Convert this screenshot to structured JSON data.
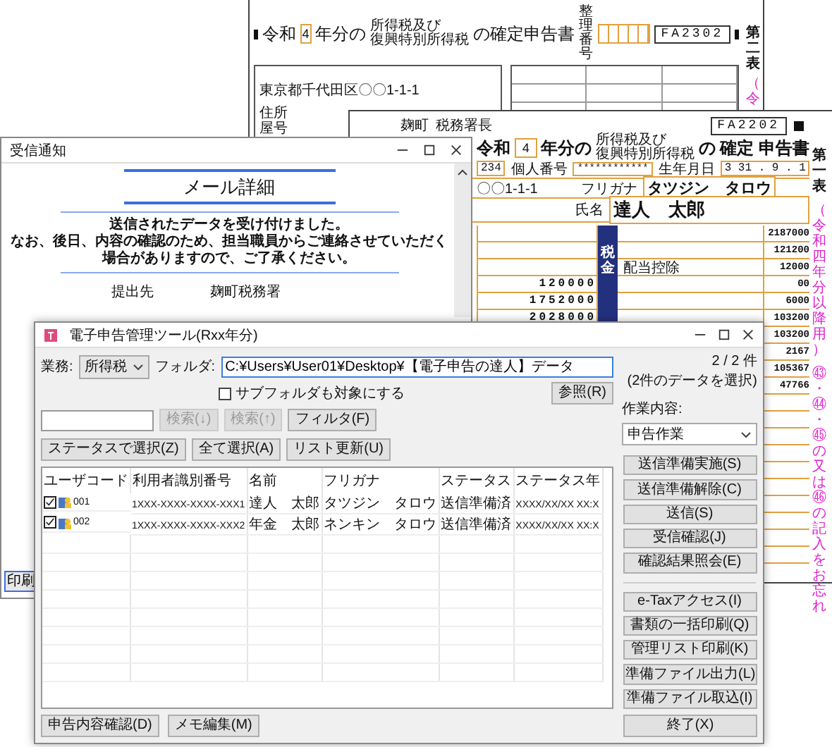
{
  "back_form": {
    "era": "令和",
    "year": "4",
    "title_prefix": "年分の",
    "title_small": [
      "所得税及び",
      "復興特別所得税"
    ],
    "title_suffix": "の確定申告書",
    "ref_label": "整理番号",
    "form_code": "FA2302",
    "address": "東京都千代田区〇〇1-1-1",
    "address_labels": [
      "住所",
      "屋号"
    ],
    "side_title": "第二表",
    "side_note": "（令"
  },
  "front_form": {
    "office": "麹町",
    "office_suffix": "税務署長",
    "form_code": "FA2202",
    "era": "令和",
    "year": "4",
    "title_prefix": "年分の",
    "title_small": [
      "所得税及び",
      "復興特別所得税"
    ],
    "title_suffix": "の",
    "title_main": "確定 申告書",
    "postal_tail": "234",
    "my_number_label": "個人番号",
    "my_number": "************",
    "birth_label": "生年月日",
    "birth_date": "3 31 . 9 . 1",
    "address_tail": "〇〇1-1-1",
    "furigana_label": "フリガナ",
    "furigana": "タツジン　タロウ",
    "name_label": "氏名",
    "name": "達人　太郎",
    "tax_section": "税金",
    "deduction_label": "配当控除",
    "left_amounts": [
      "120000",
      "1752000",
      "2028000"
    ],
    "right_amounts": [
      "2187000",
      "121200",
      "12000",
      "00",
      "6000",
      "103200",
      "103200",
      "2167",
      "105367",
      "47766"
    ],
    "side_title": "第一表",
    "side_note": "（令和四年分以降用）",
    "reminder": "㊸・㊹・㊺の又は㊻の記入をお忘れ"
  },
  "mail_window": {
    "title": "受信通知",
    "heading": "メール詳細",
    "message": [
      "送信されたデータを受け付けました。",
      "なお、後日、内容の確認のため、担当職員からご連絡させていただく",
      "場合がありますので、ご了承ください。"
    ],
    "fields": [
      {
        "label": "提出先",
        "value": "麹町税務署"
      }
    ],
    "print_button": "印刷"
  },
  "tool_window": {
    "title": "電子申告管理ツール(Rxx年分)",
    "business_label": "業務:",
    "business": "所得税",
    "folder_label": "フォルダ:",
    "folder": "C:¥Users¥User01¥Desktop¥【電子申告の達人】データ",
    "browse_button": "参照(R)",
    "subfolder": {
      "label": "サブフォルダも対象にする",
      "checked": false
    },
    "buttons": [
      {
        "label": "検索(↓)",
        "disabled": true
      },
      {
        "label": "検索(↑)",
        "disabled": true
      },
      {
        "label": "フィルタ(F)",
        "disabled": false
      },
      {
        "label": "ステータスで選択(Z)",
        "disabled": false
      },
      {
        "label": "全て選択(A)",
        "disabled": false
      },
      {
        "label": "リスト更新(U)",
        "disabled": false
      }
    ],
    "count": "2 / 2 件",
    "count_note": "(2件のデータを選択)",
    "columns": [
      "ユーザコード",
      "利用者識別番号",
      "名前",
      "フリガナ",
      "ステータス",
      "ステータス年"
    ],
    "rows": [
      {
        "checked": true,
        "user_code": "001",
        "user_id": "1XXX-XXXX-XXXX-XXX1",
        "name": "達人　太郎",
        "kana": "タツジン　タロウ",
        "status": "送信準備済",
        "status_date": "XXXX/XX/XX XX:X"
      },
      {
        "checked": true,
        "user_code": "002",
        "user_id": "1XXX-XXXX-XXXX-XXX2",
        "name": "年金　太郎",
        "kana": "ネンキン　タロウ",
        "status": "送信準備済",
        "status_date": "XXXX/XX/XX XX:X"
      }
    ],
    "task_label": "作業内容:",
    "task": "申告作業",
    "actions": [
      "送信準備実施(S)",
      "送信準備解除(C)",
      "送信(S)",
      "受信確認(J)",
      "確認結果照会(E)"
    ],
    "tools": [
      "e-Taxアクセス(I)",
      "書類の一括印刷(Q)",
      "管理リスト印刷(K)",
      "準備ファイル出力(L)",
      "準備ファイル取込(I)"
    ],
    "bottom_buttons": [
      "申告内容確認(D)",
      "メモ編集(M)"
    ],
    "exit_button": "終了(X)"
  }
}
